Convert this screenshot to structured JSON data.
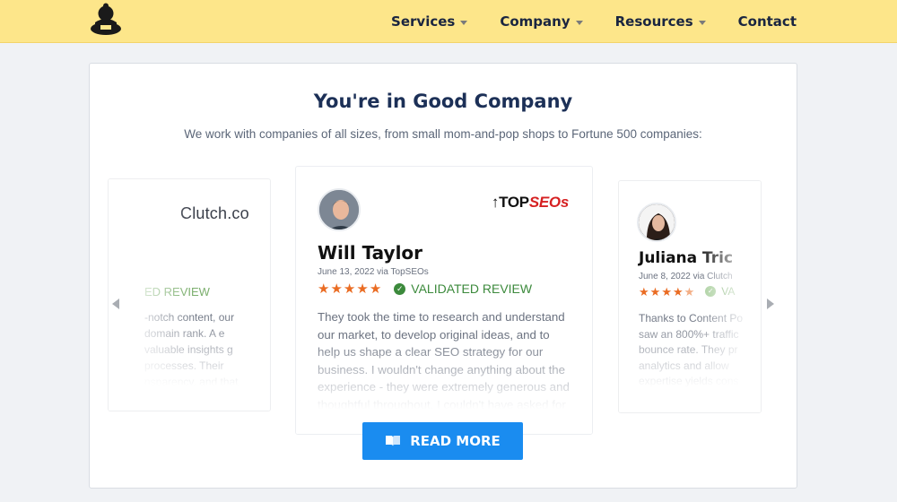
{
  "header": {
    "nav": [
      {
        "label": "Services",
        "dropdown": true
      },
      {
        "label": "Company",
        "dropdown": true
      },
      {
        "label": "Resources",
        "dropdown": true
      },
      {
        "label": "Contact",
        "dropdown": false
      }
    ],
    "background": "#fde68a"
  },
  "section": {
    "title": "You're in Good Company",
    "subtitle": "We work with companies of all sizes, from small mom-and-pop shops to Fortune 500 companies:"
  },
  "reviews": {
    "left": {
      "source_logo": "Clutch.co",
      "validated": "ED REVIEW",
      "text": "-notch content, our domain rank. A e valuable insights g processes. Their nsparency, and that stands out."
    },
    "center": {
      "name": "Will Taylor",
      "date": "June 13, 2022 via TopSEOs",
      "rating": 5,
      "source_logo_a": "TOP",
      "source_logo_b": "SEOs",
      "validated": "VALIDATED REVIEW",
      "text": "They took the time to research and understand our market, to develop original ideas, and to help us shape a clear SEO strategy for our business. I wouldn't change anything about the experience - they were extremely generous and thoughtful throughout. I couldn't have asked for"
    },
    "right": {
      "name": "Juliana Tric",
      "date": "June 8, 2022 via Clutch",
      "rating": 4.5,
      "validated": "VA",
      "text": "Thanks to Content Po saw an 800%+ traffic bounce rate. They pr analytics and allow expertise yields cons that provides value t"
    }
  },
  "cta": {
    "label": "READ MORE"
  },
  "colors": {
    "accent": "#1a8cf0",
    "star": "#ea6c23",
    "validated": "#3c8a3c",
    "title": "#1c3057"
  }
}
